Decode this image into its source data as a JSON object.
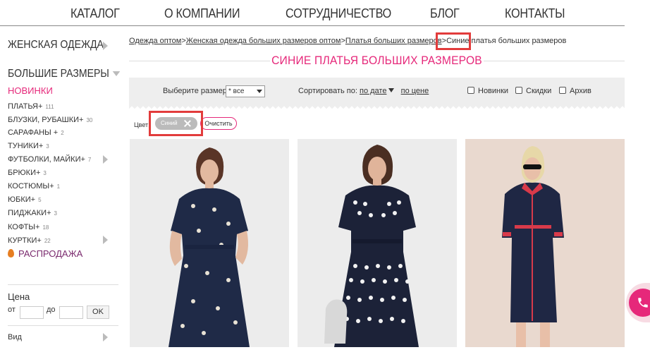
{
  "nav": [
    "КАТАЛОГ",
    "О КОМПАНИИ",
    "СОТРУДНИЧЕСТВО",
    "БЛОГ",
    "КОНТАКТЫ"
  ],
  "sidebar": {
    "womens": "ЖЕНСКАЯ ОДЕЖДА",
    "plus": "БОЛЬШИЕ РАЗМЕРЫ",
    "new": "НОВИНКИ",
    "items": [
      {
        "label": "ПЛАТЬЯ+",
        "count": "111"
      },
      {
        "label": "БЛУЗКИ, РУБАШКИ+",
        "count": "30"
      },
      {
        "label": "САРАФАНЫ +",
        "count": "2"
      },
      {
        "label": "ТУНИКИ+",
        "count": "3"
      },
      {
        "label": "ФУТБОЛКИ, МАЙКИ+",
        "count": "7"
      },
      {
        "label": "БРЮКИ+",
        "count": "3"
      },
      {
        "label": "КОСТЮМЫ+",
        "count": "1"
      },
      {
        "label": "ЮБКИ+",
        "count": "5"
      },
      {
        "label": "ПИДЖАКИ+",
        "count": "3"
      },
      {
        "label": "КОФТЫ+",
        "count": "18"
      },
      {
        "label": "КУРТКИ+",
        "count": "22"
      }
    ],
    "sale": "РАСПРОДАЖА",
    "price": "Цена",
    "from": "от",
    "to": "до",
    "ok": "OK",
    "view": "Вид"
  },
  "breadcrumb": {
    "c1": "Одежда оптом",
    "c2": "Женская одежда больших размеров оптом",
    "c3": "Платья больших размеров",
    "current_word": "Синие",
    "current_rest": " платья больших размеров"
  },
  "title": "СИНИЕ ПЛАТЬЯ БОЛЬШИХ РАЗМЕРОВ",
  "filters": {
    "size_label": "Выберите размер",
    "size_value": "* все",
    "sort_label": "Сортировать по:",
    "sort_date": "по дате",
    "sort_price": "по цене",
    "new": "Новинки",
    "discounts": "Скидки",
    "archive": "Архив",
    "color_label": "Цвет:",
    "chip": "Синий",
    "clear": "Очистить"
  },
  "colors": {
    "accent": "#e6287a",
    "highlight": "#e23c3c",
    "filterbar": "#eeeeee"
  }
}
